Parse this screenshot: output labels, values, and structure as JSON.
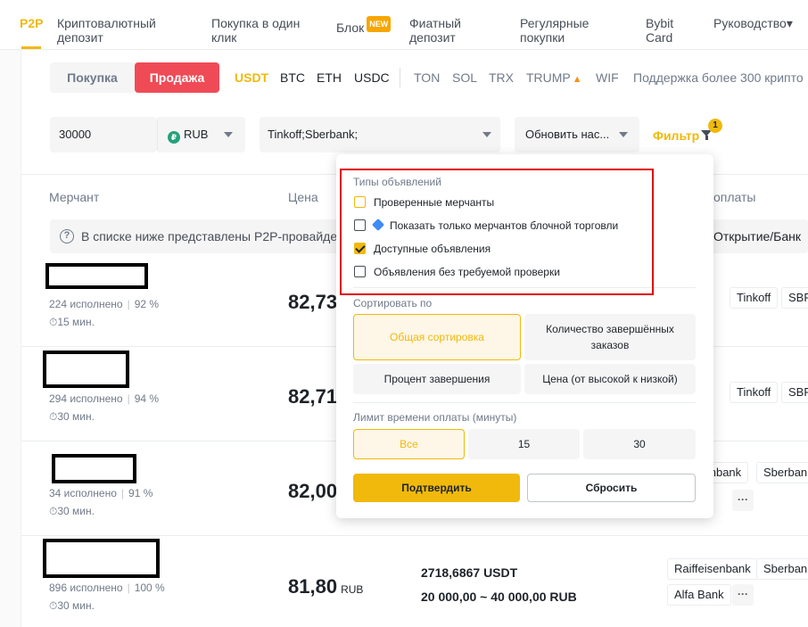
{
  "nav": {
    "items": [
      "P2P",
      "Криптовалютный депозит",
      "Покупка в один клик",
      "Блок",
      "Фиатный депозит",
      "Регулярные покупки",
      "Bybit Card",
      "Руководство"
    ],
    "new_badge": "NEW",
    "guide_caret": "▾"
  },
  "trade_toggle": {
    "buy": "Покупка",
    "sell": "Продажа"
  },
  "coins": [
    "USDT",
    "BTC",
    "ETH",
    "USDC",
    "TON",
    "SOL",
    "TRX",
    "TRUMP",
    "WIF"
  ],
  "more_coins": "Поддержка более 300 крипто",
  "filters": {
    "amount": "30000",
    "currency": "RUB",
    "currency_icon": "₽",
    "payment": "Tinkoff;Sberbank;",
    "refresh": "Обновить нас...",
    "filter_label": "Фильтр",
    "filter_count": "1"
  },
  "table": {
    "headers": {
      "merchant": "Мерчант",
      "price": "Цена",
      "payment": "оплаты"
    },
    "notice": "В списке ниже представлены P2P-провайде",
    "notice_icon": "?",
    "notice_right": "Открытие/Банк",
    "rows": [
      {
        "stats": "224 исполнено",
        "rate": "92 %",
        "time": "15 мин.",
        "price": "82,73",
        "chips": [
          "k",
          "Tinkoff",
          "SBP"
        ]
      },
      {
        "stats": "294 исполнено",
        "rate": "94 %",
        "time": "30 мин.",
        "price": "82,71",
        "chips": [
          "k",
          "Tinkoff",
          "SBP"
        ]
      },
      {
        "stats": "34 исполнено",
        "rate": "91 %",
        "time": "30 мин.",
        "price": "82,00",
        "chips": [
          "senbank",
          "Sberbank",
          "···"
        ]
      },
      {
        "stats": "896 исполнено",
        "rate": "100 %",
        "time": "30 мин.",
        "price": "81,80",
        "currency": "RUB",
        "available": "2718,6867 USDT",
        "limit": "20 000,00 ~ 40 000,00 RUB",
        "chips": [
          "Raiffeisenbank",
          "Sberbank",
          "Alfa Bank",
          "···"
        ]
      }
    ],
    "clock_icon": "⏱"
  },
  "popup": {
    "ad_types_title": "Типы объявлений",
    "checkboxes": [
      {
        "label": "Проверенные мерчанты",
        "checked": false
      },
      {
        "label": "Показать только мерчантов блочной торговли",
        "checked": false
      },
      {
        "label": "Доступные объявления",
        "checked": true
      },
      {
        "label": "Объявления без требуемой проверки",
        "checked": false
      }
    ],
    "sort_title": "Сортировать по",
    "sort_options": [
      "Общая сортировка",
      "Количество завершённых заказов",
      "Процент завершения",
      "Цена (от высокой к низкой)"
    ],
    "time_title": "Лимит времени оплаты (минуты)",
    "time_options": [
      "Все",
      "15",
      "30"
    ],
    "confirm": "Подтвердить",
    "reset": "Сбросить"
  },
  "colors": {
    "accent": "#f0b90b",
    "sell": "#ef4b57",
    "highlight_box": "#e00000"
  }
}
